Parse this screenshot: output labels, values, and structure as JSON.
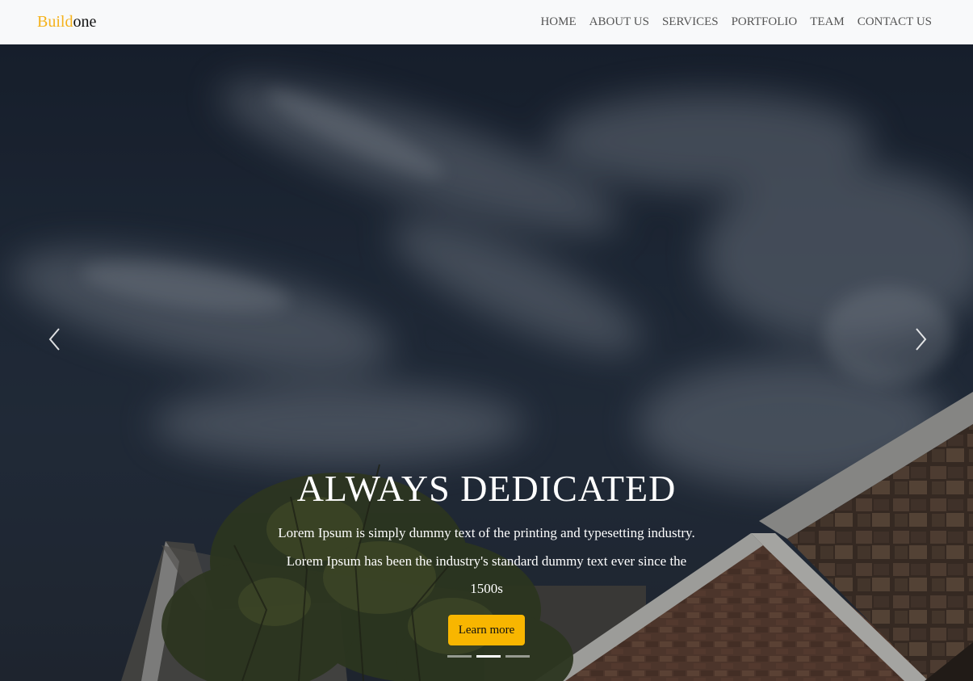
{
  "brand": {
    "part1": "Build",
    "part2": "one"
  },
  "nav": {
    "items": [
      {
        "label": "HOME"
      },
      {
        "label": "ABOUT US"
      },
      {
        "label": "SERVICES"
      },
      {
        "label": "PORTFOLIO"
      },
      {
        "label": "TEAM"
      },
      {
        "label": "CONTACT US"
      }
    ]
  },
  "hero": {
    "title": "ALWAYS DEDICATED",
    "text": "Lorem Ipsum is simply dummy text of the printing and typesetting industry. Lorem Ipsum has been the industry's standard dummy text ever since the 1500s",
    "button_label": "Learn more",
    "active_slide": 2,
    "slide_count": 3
  },
  "colors": {
    "brand_accent": "#f5b21b",
    "button": "#f8b600",
    "navbar_bg": "#f8f9fa"
  },
  "icons": {
    "prev": "chevron-left-icon",
    "next": "chevron-right-icon"
  }
}
